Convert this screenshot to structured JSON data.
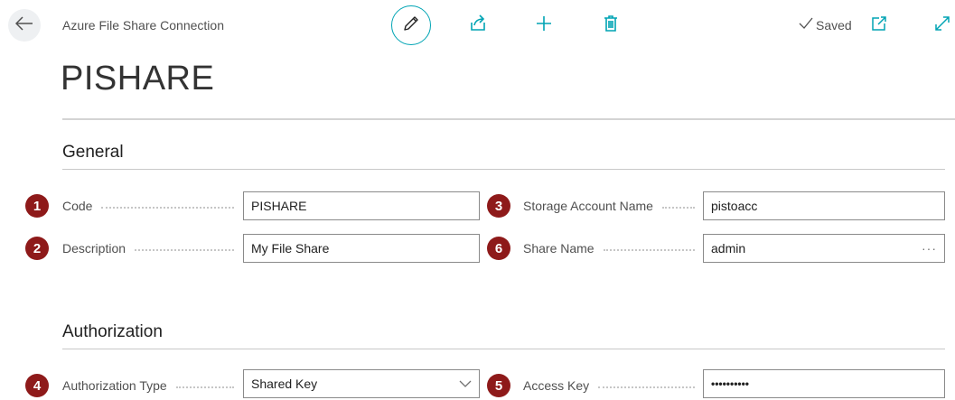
{
  "header": {
    "caption": "Azure File Share Connection",
    "status": "Saved",
    "icons": [
      "back-arrow-icon",
      "pencil-icon",
      "share-icon",
      "plus-icon",
      "trash-icon",
      "checkmark-icon",
      "popout-icon",
      "expand-icon"
    ]
  },
  "record": {
    "title": "PISHARE"
  },
  "general": {
    "title": "General",
    "code": {
      "badge": "1",
      "label": "Code",
      "value": "PISHARE"
    },
    "description": {
      "badge": "2",
      "label": "Description",
      "value": "My File Share"
    },
    "storage_account": {
      "badge": "3",
      "label": "Storage Account Name",
      "value": "pistoacc"
    },
    "share_name": {
      "badge": "6",
      "label": "Share Name",
      "value": "admin",
      "assist": "···"
    }
  },
  "authorization": {
    "title": "Authorization",
    "auth_type": {
      "badge": "4",
      "label": "Authorization Type",
      "value": "Shared Key"
    },
    "access_key": {
      "badge": "5",
      "label": "Access Key",
      "value": "••••••••••"
    }
  },
  "colors": {
    "accent": "#00a4b4",
    "badge": "#8e1a1a",
    "text": "#212121",
    "muted": "#505050"
  }
}
